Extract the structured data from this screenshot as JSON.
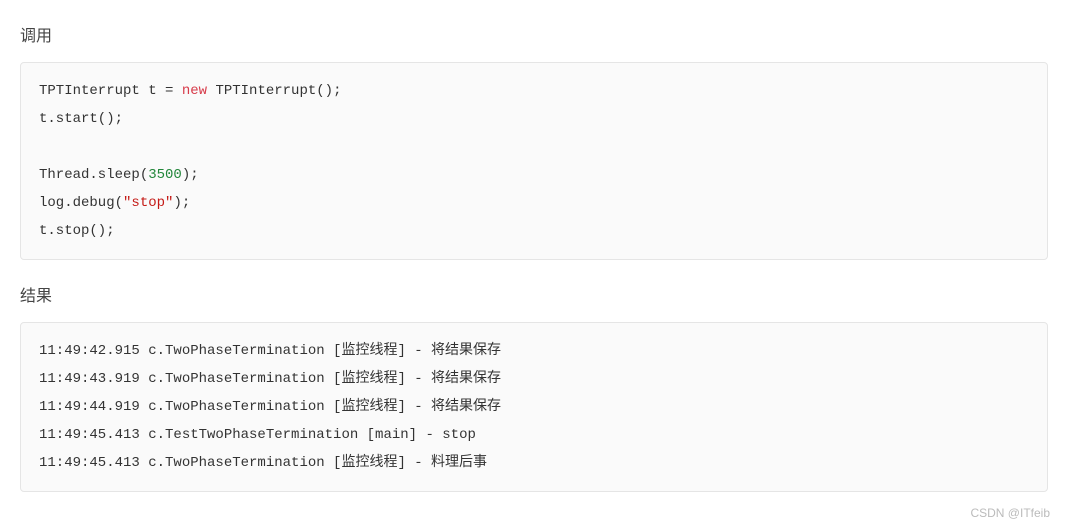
{
  "heading1": "调用",
  "heading2": "结果",
  "code1": {
    "line1_pre": "TPTInterrupt t = ",
    "line1_new": "new",
    "line1_post": " TPTInterrupt();",
    "line2": "t.start();",
    "line3": "",
    "line4_pre": "Thread.sleep(",
    "line4_num": "3500",
    "line4_post": ");",
    "line5_pre": "log.debug(",
    "line5_str": "\"stop\"",
    "line5_post": ");",
    "line6": "t.stop();"
  },
  "code2": {
    "line1": "11:49:42.915 c.TwoPhaseTermination [监控线程] - 将结果保存",
    "line2": "11:49:43.919 c.TwoPhaseTermination [监控线程] - 将结果保存",
    "line3": "11:49:44.919 c.TwoPhaseTermination [监控线程] - 将结果保存",
    "line4": "11:49:45.413 c.TestTwoPhaseTermination [main] - stop",
    "line5": "11:49:45.413 c.TwoPhaseTermination [监控线程] - 料理后事"
  },
  "watermark": "CSDN @ITfeib"
}
